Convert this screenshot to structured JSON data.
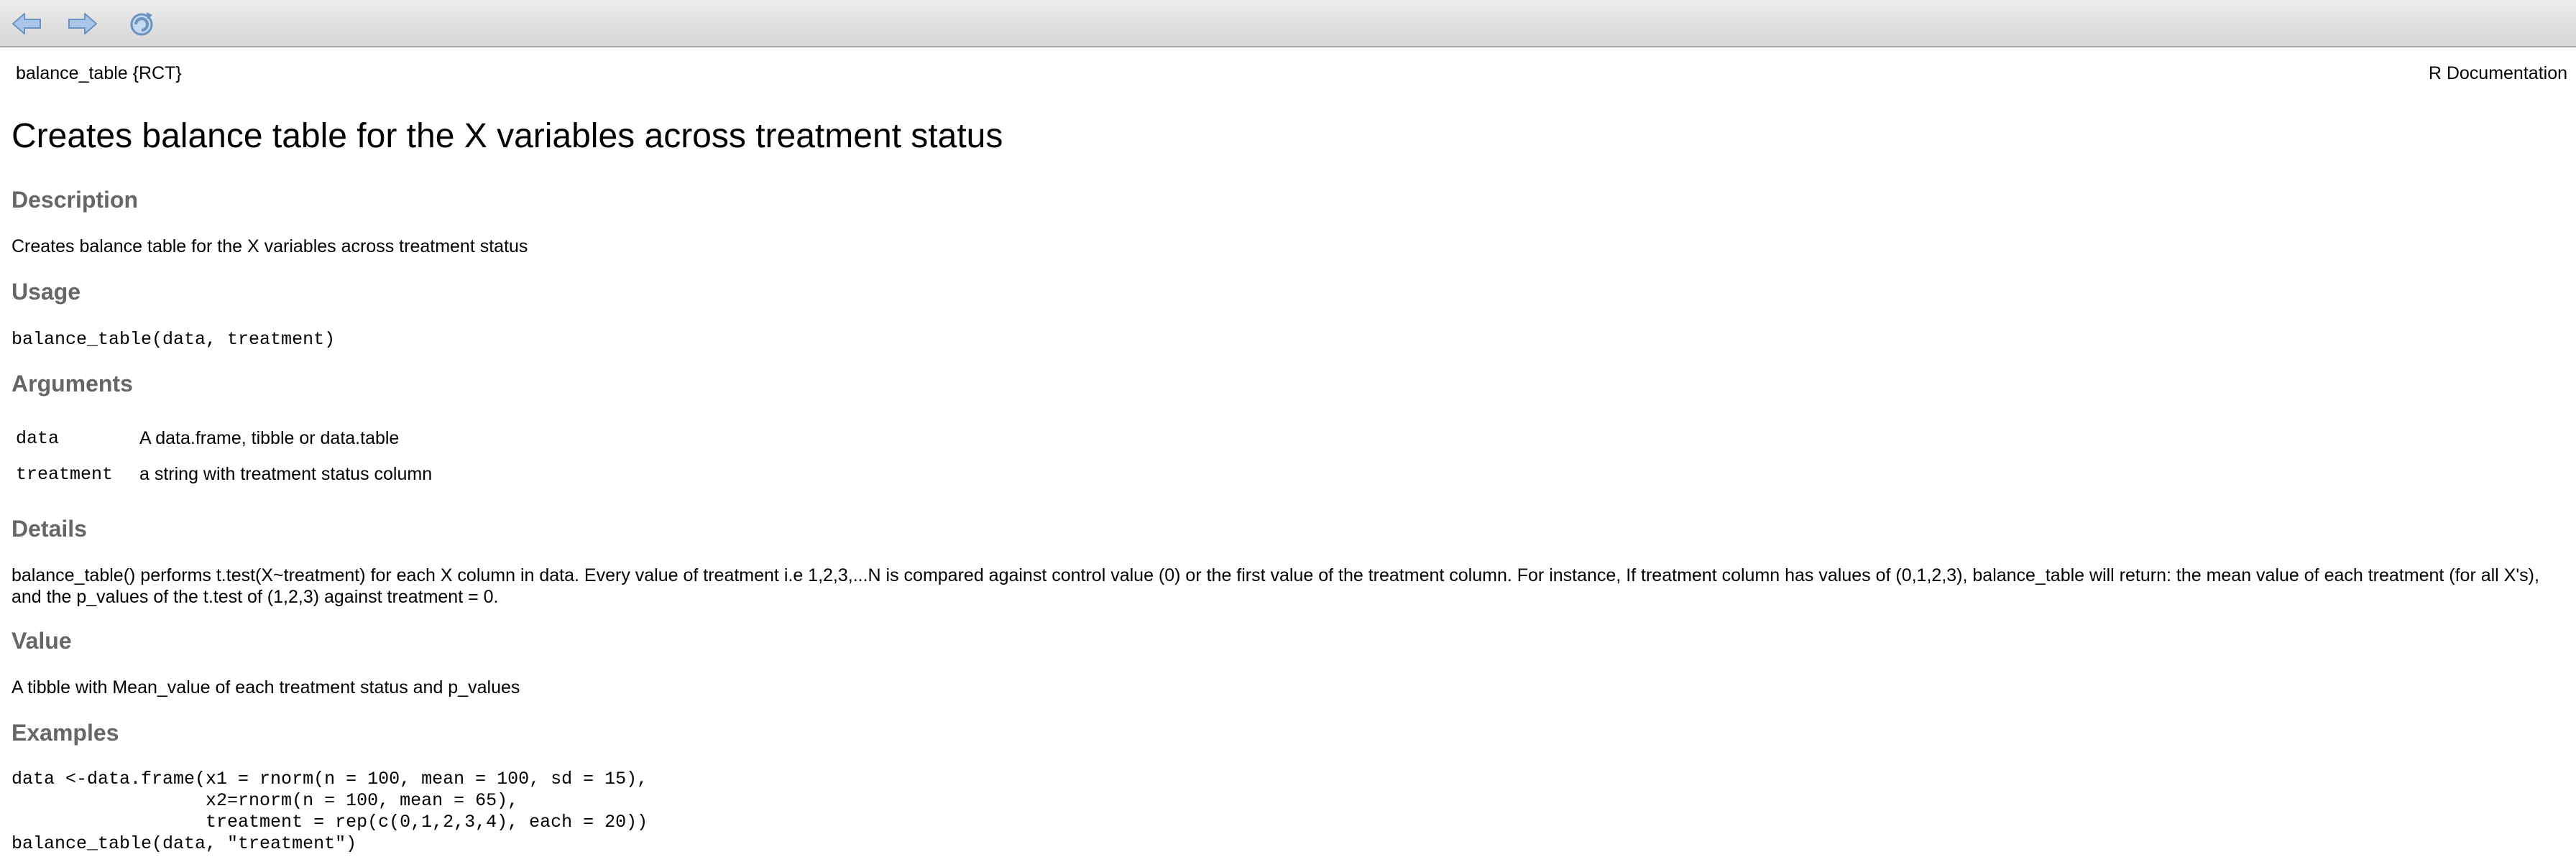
{
  "toolbar": {
    "back_icon": "arrow-left-icon",
    "forward_icon": "arrow-right-icon",
    "refresh_icon": "refresh-icon",
    "icon_color": "#8fb4dd"
  },
  "header": {
    "topic": "balance_table {RCT}",
    "source": "R Documentation"
  },
  "title": "Creates balance table for the X variables across treatment status",
  "sections": {
    "description": {
      "heading": "Description",
      "text": "Creates balance table for the X variables across treatment status"
    },
    "usage": {
      "heading": "Usage",
      "code": "balance_table(data, treatment)"
    },
    "arguments": {
      "heading": "Arguments",
      "items": [
        {
          "name": "data",
          "desc": "A data.frame, tibble or data.table"
        },
        {
          "name": "treatment",
          "desc": "a string with treatment status column"
        }
      ]
    },
    "details": {
      "heading": "Details",
      "text": "balance_table() performs t.test(X~treatment) for each X column in data. Every value of treatment i.e 1,2,3,...N is compared against control value (0) or the first value of the treatment column. For instance, If treatment column has values of (0,1,2,3), balance_table will return: the mean value of each treatment (for all X's), and the p_values of the t.test of (1,2,3) against treatment = 0."
    },
    "value": {
      "heading": "Value",
      "text": "A tibble with Mean_value of each treatment status and p_values"
    },
    "examples": {
      "heading": "Examples",
      "code": "data <-data.frame(x1 = rnorm(n = 100, mean = 100, sd = 15),\n                  x2=rnorm(n = 100, mean = 65),\n                  treatment = rep(c(0,1,2,3,4), each = 20))\nbalance_table(data, \"treatment\")"
    }
  }
}
